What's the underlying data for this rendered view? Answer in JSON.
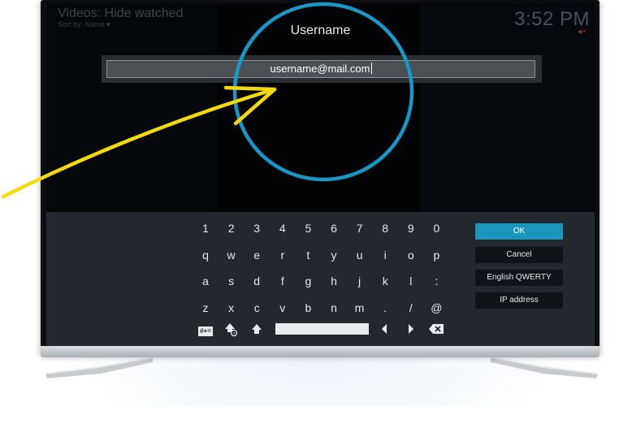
{
  "header": {
    "title": "Videos: Hide watched",
    "sort": "Sort by: Name",
    "clock": "3:52 PM"
  },
  "dialog": {
    "title": "Username",
    "value": "username@mail.com"
  },
  "keyboard": {
    "rows": [
      [
        "1",
        "2",
        "3",
        "4",
        "5",
        "6",
        "7",
        "8",
        "9",
        "0"
      ],
      [
        "q",
        "w",
        "e",
        "r",
        "t",
        "y",
        "u",
        "i",
        "o",
        "p"
      ],
      [
        "a",
        "s",
        "d",
        "f",
        "g",
        "h",
        "j",
        "k",
        "l",
        ":"
      ],
      [
        "z",
        "x",
        "c",
        "v",
        "b",
        "n",
        "m",
        ".",
        "/",
        "@"
      ]
    ],
    "symbols_label": "#+="
  },
  "buttons": {
    "ok": "OK",
    "cancel": "Cancel",
    "layout": "English QWERTY",
    "ip": "IP address"
  },
  "annotation": {
    "circle_color": "#1b97c7",
    "arrow_color": "#f5d90c"
  }
}
